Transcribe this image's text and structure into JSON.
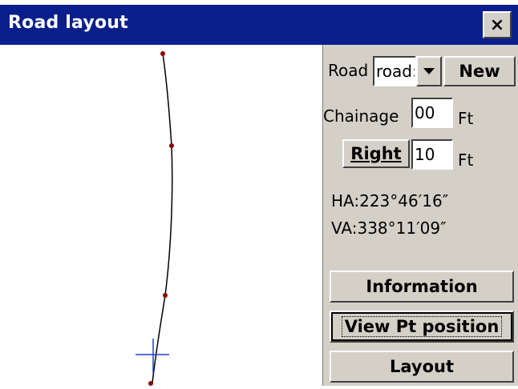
{
  "window": {
    "title": "Road layout",
    "close_glyph": "×"
  },
  "panel": {
    "road_label": "Road",
    "road_value": "road:",
    "new_button": "New",
    "chainage_label": "Chainage",
    "chainage_value": "00",
    "chainage_unit": "Ft",
    "side_button": "Right",
    "offset_value": "10",
    "offset_unit": "Ft",
    "ha": "HA:223°46′16″",
    "va": "VA:338°11′09″",
    "information_button": "Information",
    "view_pt_button": "View Pt position",
    "layout_button": "Layout"
  },
  "colors": {
    "title_bg": "#0a1e8c",
    "panel_bg": "#d4d0c8",
    "point": "#8b0000",
    "cursor": "#2040c0"
  }
}
